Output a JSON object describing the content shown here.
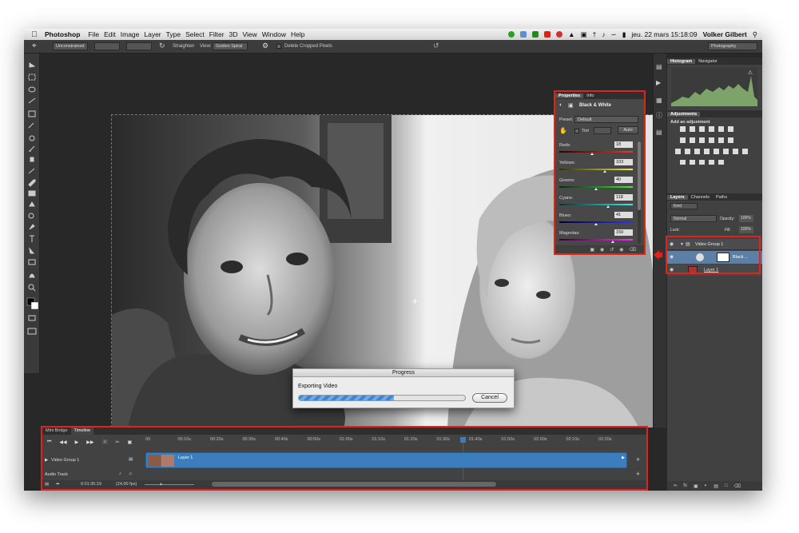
{
  "menubar": {
    "app": "Photoshop",
    "items": [
      "File",
      "Edit",
      "Image",
      "Layer",
      "Type",
      "Select",
      "Filter",
      "3D",
      "View",
      "Window",
      "Help"
    ],
    "datetime": "jeu. 22 mars  15:18:09",
    "user": "Volker Gilbert"
  },
  "options": {
    "ratio": "Unconstrained",
    "straighten": "Straighten",
    "view_label": "View:",
    "view_value": "Golden Spiral",
    "delete_cropped": "Delete Cropped Pixels",
    "workspace": "Photography"
  },
  "histogram": {
    "tab1": "Histogram",
    "tab2": "Navigator"
  },
  "adjustments": {
    "tab": "Adjustments",
    "add": "Add an adjustment"
  },
  "layers": {
    "tabs": [
      "Layers",
      "Channels",
      "Paths"
    ],
    "kind": "Kind",
    "blend": "Normal",
    "opacity_label": "Opacity:",
    "opacity": "100%",
    "lock_label": "Lock:",
    "fill_label": "Fill:",
    "fill": "100%",
    "group": "Video Group 1",
    "adj_layer": "Black ...",
    "layer": "Layer 1"
  },
  "properties": {
    "tabs": [
      "Properties",
      "Info"
    ],
    "title": "Black & White",
    "preset_label": "Preset:",
    "preset": "Default",
    "tint": "Tint",
    "auto": "Auto",
    "sliders": [
      {
        "name": "Reds:",
        "value": "18",
        "pos": 0.45
      },
      {
        "name": "Yellows:",
        "value": "103",
        "pos": 0.62
      },
      {
        "name": "Greens:",
        "value": "40",
        "pos": 0.5
      },
      {
        "name": "Cyans:",
        "value": "118",
        "pos": 0.66
      },
      {
        "name": "Blues:",
        "value": "41",
        "pos": 0.5
      },
      {
        "name": "Magentas:",
        "value": "150",
        "pos": 0.73
      }
    ]
  },
  "timeline": {
    "tabs": [
      "Mini Bridge",
      "Timeline"
    ],
    "ticks": [
      "00",
      "00:10s",
      "00:20s",
      "00:30s",
      "00:40s",
      "00:50s",
      "01:00s",
      "01:10s",
      "01:20s",
      "01:30s",
      "01:40s",
      "01:50s",
      "02:00s",
      "02:10s",
      "02:20s"
    ],
    "track": "Video Group 1",
    "clip": "Layer 1",
    "audio": "Audio Track",
    "timecode": "0:01:35:19",
    "fps": "(24,00 fps)"
  },
  "progress": {
    "title": "Progress",
    "message": "Exporting Video",
    "cancel": "Cancel",
    "fraction": 0.57
  },
  "colors": {
    "highlight": "#e2231a",
    "clip": "#3b7dbd"
  }
}
